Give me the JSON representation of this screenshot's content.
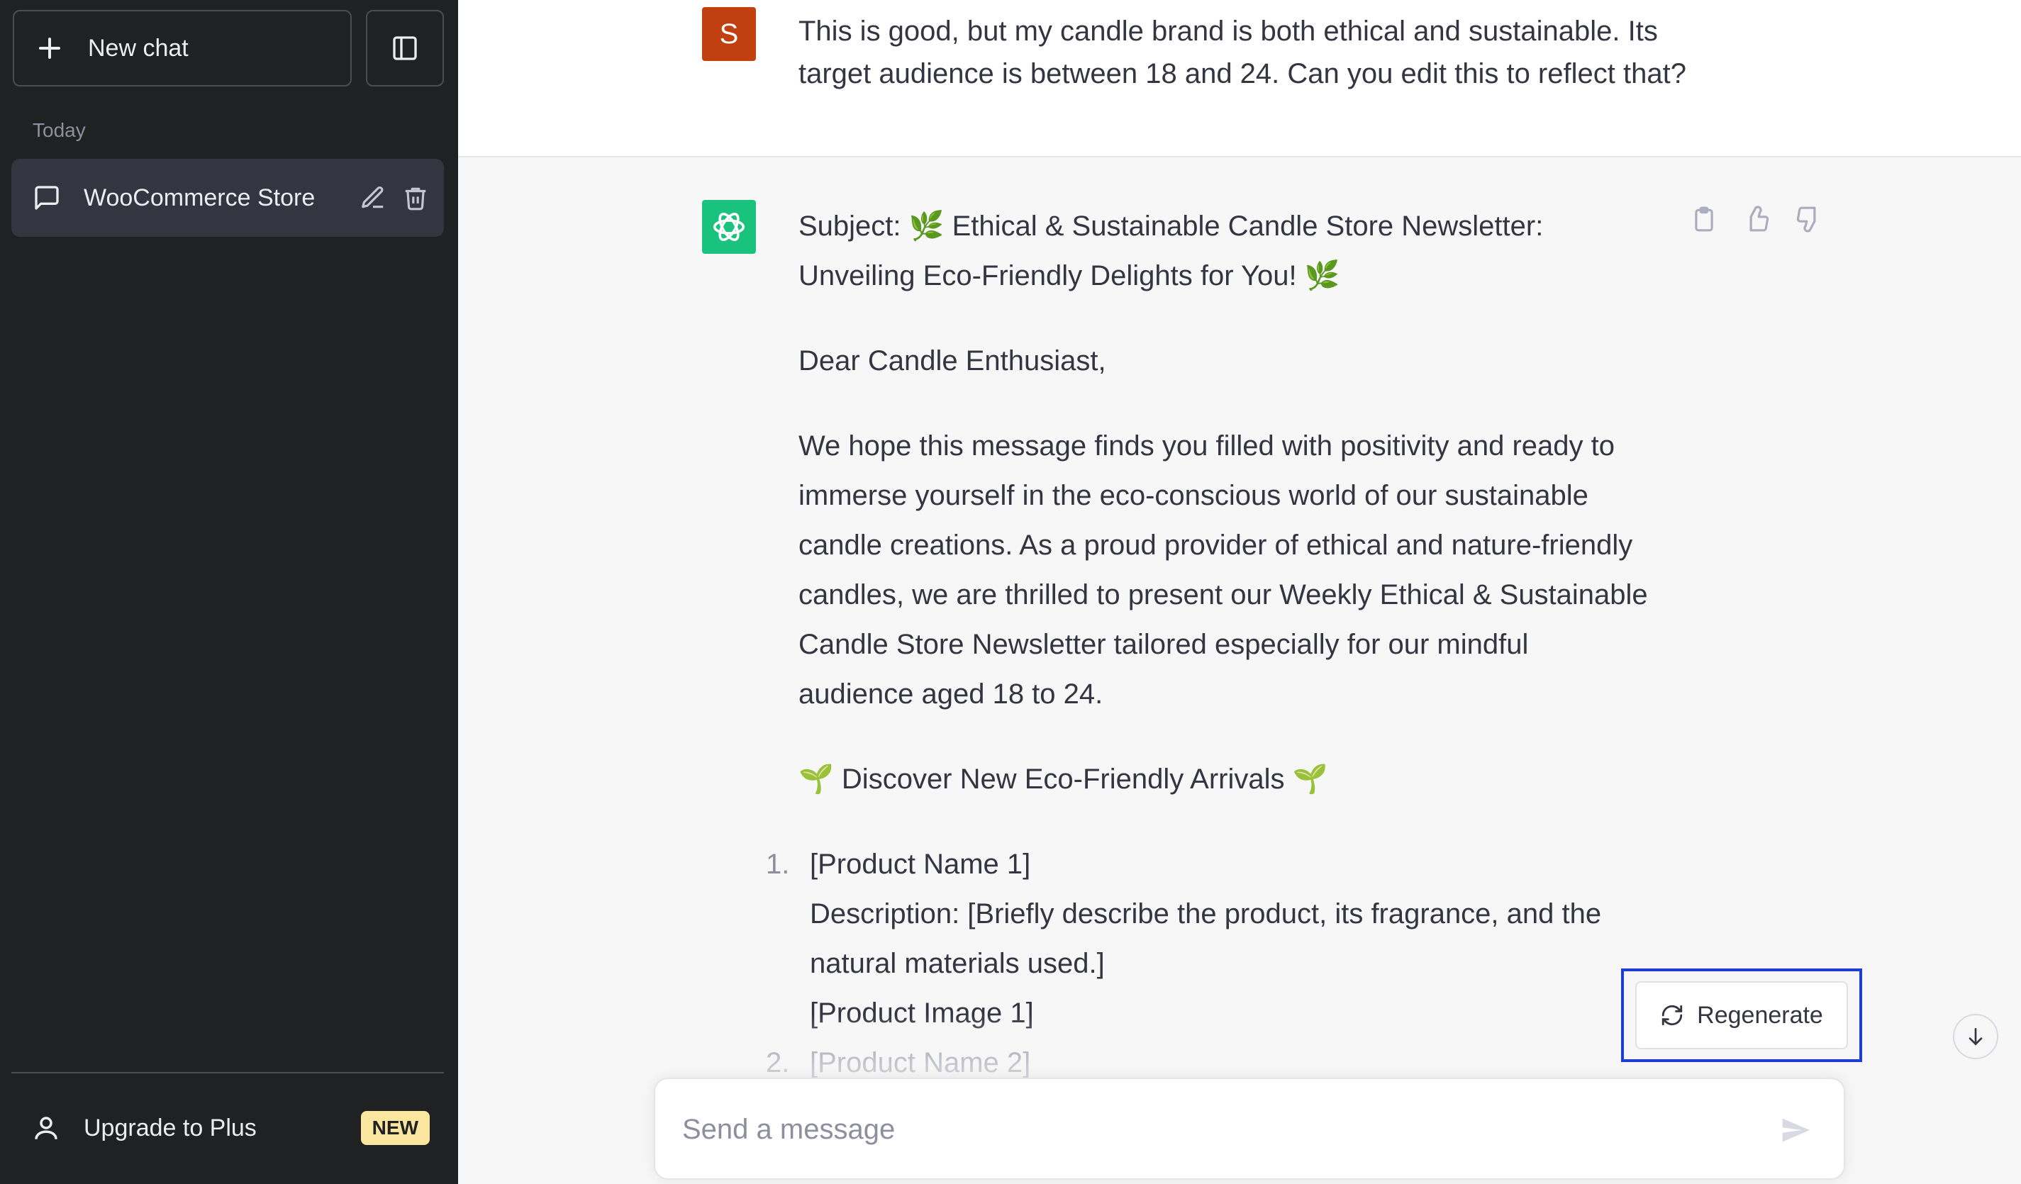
{
  "sidebar": {
    "new_chat_label": "New chat",
    "section_label": "Today",
    "chats": [
      {
        "title": "WooCommerce Store"
      }
    ],
    "upgrade_label": "Upgrade to Plus",
    "upgrade_badge": "NEW"
  },
  "conversation": {
    "user_avatar_initial": "S",
    "user_message": "This is good, but my candle brand is both ethical and sustainable. Its target audience is between 18 and 24. Can you edit this to reflect that?",
    "assistant": {
      "subject": "Subject: 🌿 Ethical & Sustainable Candle Store Newsletter: Unveiling Eco-Friendly Delights for You! 🌿",
      "greeting": "Dear Candle Enthusiast,",
      "intro": "We hope this message finds you filled with positivity and ready to immerse yourself in the eco-conscious world of our sustainable candle creations. As a proud provider of ethical and nature-friendly candles, we are thrilled to present our Weekly Ethical & Sustainable Candle Store Newsletter tailored especially for our mindful audience aged 18 to 24.",
      "section_heading": "🌱 Discover New Eco-Friendly Arrivals 🌱",
      "items": [
        {
          "num": "1.",
          "name": "[Product Name 1]",
          "description": "Description: [Briefly describe the product, its fragrance, and the natural materials used.]",
          "image": "[Product Image 1]"
        },
        {
          "num": "2.",
          "name": "[Product Name 2]"
        }
      ]
    }
  },
  "regenerate_label": "Regenerate",
  "composer": {
    "placeholder": "Send a message"
  },
  "colors": {
    "sidebar_bg": "#202123",
    "user_avatar": "#c1400f",
    "bot_avatar": "#19c37d",
    "highlight": "#1a3fd9",
    "badge": "#fae69e"
  }
}
